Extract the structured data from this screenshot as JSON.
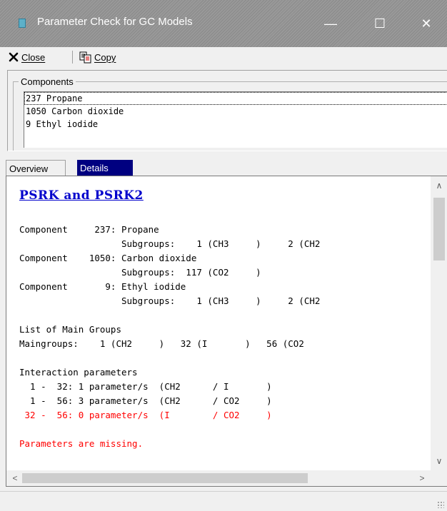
{
  "window": {
    "title": "Parameter Check for GC Models",
    "controls": {
      "minimize": "—",
      "maximize": "☐",
      "close": "✕"
    }
  },
  "toolbar": {
    "close_label": "Close",
    "copy_label": "Copy"
  },
  "components": {
    "legend": "Components",
    "items": [
      "237 Propane",
      "1050 Carbon dioxide",
      "9 Ethyl iodide"
    ],
    "selected_index": 0
  },
  "tabs": [
    {
      "label": "Overview",
      "active": false
    },
    {
      "label": "Details",
      "active": true
    }
  ],
  "details": {
    "heading": "PSRK and PSRK2",
    "lines": [
      {
        "text": "Component     237: Propane",
        "color": "#000000"
      },
      {
        "text": "                   Subgroups:    1 (CH3     )     2 (CH2",
        "color": "#000000"
      },
      {
        "text": "Component    1050: Carbon dioxide",
        "color": "#000000"
      },
      {
        "text": "                   Subgroups:  117 (CO2     )",
        "color": "#000000"
      },
      {
        "text": "Component       9: Ethyl iodide",
        "color": "#000000"
      },
      {
        "text": "                   Subgroups:    1 (CH3     )     2 (CH2",
        "color": "#000000"
      },
      {
        "text": "",
        "color": "#000000"
      },
      {
        "text": "List of Main Groups",
        "color": "#000000"
      },
      {
        "text": "Maingroups:    1 (CH2     )   32 (I       )   56 (CO2",
        "color": "#000000"
      },
      {
        "text": "",
        "color": "#000000"
      },
      {
        "text": "Interaction parameters",
        "color": "#000000"
      },
      {
        "text": "  1 -  32: 1 parameter/s  (CH2      / I       )",
        "color": "#000000"
      },
      {
        "text": "  1 -  56: 3 parameter/s  (CH2      / CO2     )",
        "color": "#000000"
      },
      {
        "text": " 32 -  56: 0 parameter/s  (I        / CO2     )",
        "color": "#ff0000"
      },
      {
        "text": "",
        "color": "#000000"
      },
      {
        "text": "Parameters are missing.",
        "color": "#ff0000"
      }
    ]
  },
  "colors": {
    "accent_tab": "#000080",
    "heading": "#0000cc",
    "error": "#ff0000"
  }
}
